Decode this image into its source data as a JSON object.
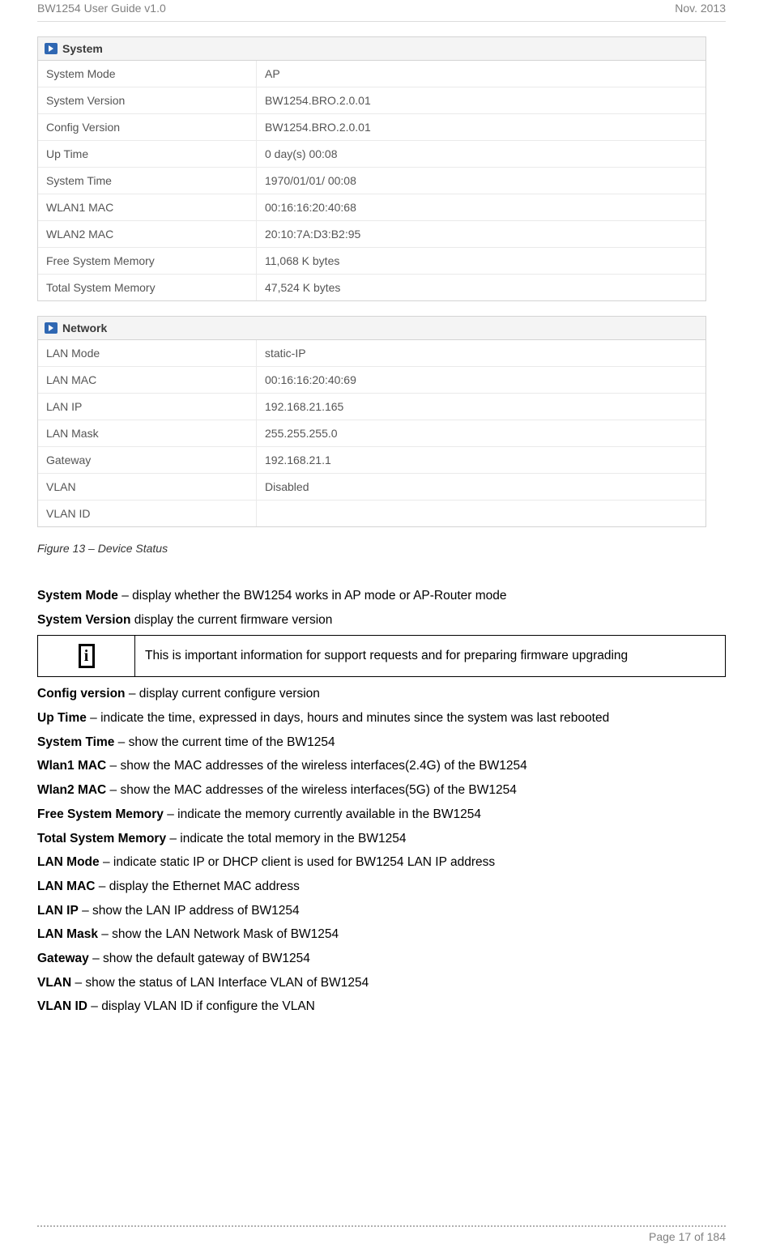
{
  "header": {
    "left": "BW1254 User Guide v1.0",
    "right": "Nov.  2013"
  },
  "panels": {
    "system": {
      "title": "System",
      "rows": [
        {
          "label": "System Mode",
          "value": "AP"
        },
        {
          "label": "System Version",
          "value": "BW1254.BRO.2.0.01"
        },
        {
          "label": "Config Version",
          "value": "BW1254.BRO.2.0.01"
        },
        {
          "label": "Up Time",
          "value": "0 day(s) 00:08"
        },
        {
          "label": "System Time",
          "value": "1970/01/01/ 00:08"
        },
        {
          "label": "WLAN1 MAC",
          "value": "00:16:16:20:40:68"
        },
        {
          "label": "WLAN2 MAC",
          "value": "20:10:7A:D3:B2:95"
        },
        {
          "label": "Free System Memory",
          "value": "11,068 K bytes"
        },
        {
          "label": "Total System Memory",
          "value": "47,524 K bytes"
        }
      ]
    },
    "network": {
      "title": "Network",
      "rows": [
        {
          "label": "LAN Mode",
          "value": "static-IP"
        },
        {
          "label": "LAN MAC",
          "value": "00:16:16:20:40:69"
        },
        {
          "label": "LAN IP",
          "value": "192.168.21.165"
        },
        {
          "label": "LAN Mask",
          "value": "255.255.255.0"
        },
        {
          "label": "Gateway",
          "value": "192.168.21.1"
        },
        {
          "label": "VLAN",
          "value": "Disabled"
        },
        {
          "label": "VLAN ID",
          "value": ""
        }
      ]
    }
  },
  "figure_caption": "Figure 13  – Device Status",
  "definitions": [
    {
      "term": "System Mode",
      "desc": " – display whether the BW1254 works in AP mode or AP-Router mode"
    },
    {
      "term": "System Version",
      "desc": " display the current firmware version"
    }
  ],
  "info_box": {
    "glyph": "i",
    "text": "This is important information for support requests and for preparing firmware upgrading"
  },
  "definitions2": [
    {
      "term": "Config version",
      "desc": " – display current configure version"
    },
    {
      "term": "Up Time",
      "desc": " – indicate the time, expressed in days, hours and minutes since the system was last rebooted"
    },
    {
      "term": "System Time",
      "desc": " – show the current time of the BW1254"
    },
    {
      "term": "Wlan1 MAC",
      "desc": " – show the MAC addresses of the wireless interfaces(2.4G) of the BW1254"
    },
    {
      "term": "Wlan2 MAC",
      "desc": " – show the MAC addresses of the wireless interfaces(5G) of the BW1254"
    },
    {
      "term": "Free System Memory",
      "desc": " – indicate the memory currently available in the BW1254"
    },
    {
      "term": "Total System Memory",
      "desc": " – indicate the total memory in the BW1254"
    },
    {
      "term": "LAN Mode",
      "desc": " – indicate static IP or DHCP client is used for BW1254 LAN IP address"
    },
    {
      "term": "LAN MAC",
      "desc": " – display the Ethernet MAC address"
    },
    {
      "term": "LAN IP",
      "desc": " – show the LAN IP address of BW1254"
    },
    {
      "term": "LAN Mask",
      "desc": " – show the LAN Network Mask of BW1254"
    },
    {
      "term": "Gateway",
      "desc": " – show the default gateway of BW1254"
    },
    {
      "term": "VLAN",
      "desc": " – show the status of LAN Interface VLAN of BW1254"
    },
    {
      "term": "VLAN ID",
      "desc": " – display VLAN ID if configure the VLAN"
    }
  ],
  "footer": {
    "page": "Page 17 of 184"
  }
}
